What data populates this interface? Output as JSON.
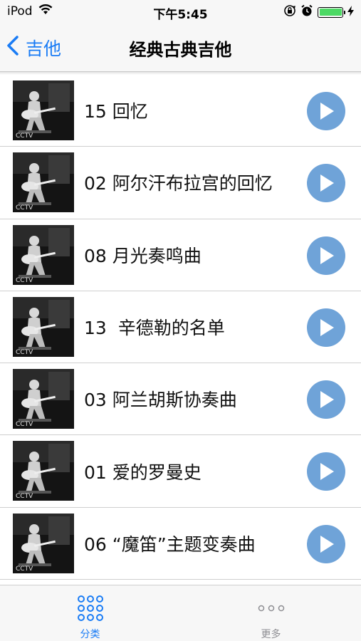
{
  "status_bar": {
    "carrier": "iPod",
    "time": "下午5:45",
    "battery_level": 1.0,
    "battery_color": "#4cd964"
  },
  "nav": {
    "back_label": "吉他",
    "title": "经典古典吉他",
    "accent_color": "#1a7cf5"
  },
  "tracks": [
    {
      "title": "15 回忆"
    },
    {
      "title": "02 阿尔汗布拉宫的回忆"
    },
    {
      "title": "08 月光奏鸣曲"
    },
    {
      "title": "13  辛德勒的名单"
    },
    {
      "title": "03 阿兰胡斯协奏曲"
    },
    {
      "title": "01 爱的罗曼史"
    },
    {
      "title": "06 “魔笛”主题变奏曲"
    }
  ],
  "thumbnail_icon": "guitarist-photo-thumbnail",
  "play_icon": "play-icon",
  "tab_bar": {
    "items": [
      {
        "label": "分类",
        "icon": "grid-dots-icon",
        "active": true
      },
      {
        "label": "更多",
        "icon": "more-dots-icon",
        "active": false
      }
    ]
  }
}
